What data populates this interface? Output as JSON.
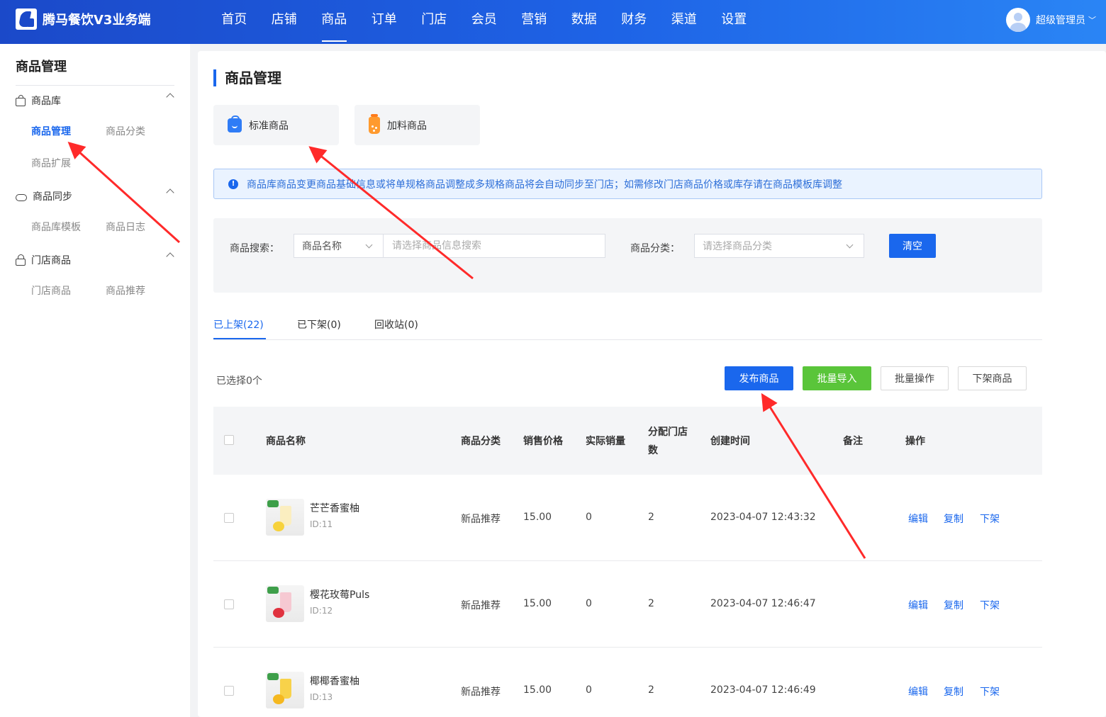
{
  "app": {
    "title": "腾马餐饮V3业务端"
  },
  "nav": [
    "首页",
    "店铺",
    "商品",
    "订单",
    "门店",
    "会员",
    "营销",
    "数据",
    "财务",
    "渠道",
    "设置"
  ],
  "user": {
    "name": "超级管理员"
  },
  "sidebar": {
    "title": "商品管理",
    "groups": [
      {
        "label": "商品库",
        "items": [
          "商品管理",
          "商品分类",
          "商品扩展"
        ]
      },
      {
        "label": "商品同步",
        "items": [
          "商品库模板",
          "商品日志"
        ]
      },
      {
        "label": "门店商品",
        "items": [
          "门店商品",
          "商品推荐"
        ]
      }
    ]
  },
  "page": {
    "title": "商品管理"
  },
  "type_cards": [
    "标准商品",
    "加料商品"
  ],
  "notice": "商品库商品变更商品基础信息或将单规格商品调整成多规格商品将会自动同步至门店；如需修改门店商品价格或库存请在商品模板库调整",
  "filter": {
    "search_label": "商品搜索：",
    "search_field": "商品名称",
    "search_placeholder": "请选择商品信息搜索",
    "category_label": "商品分类：",
    "category_placeholder": "请选择商品分类",
    "clear": "清空"
  },
  "tabs": [
    "已上架(22)",
    "已下架(0)",
    "回收站(0)"
  ],
  "toolbar": {
    "selected": "已选择0个",
    "publish": "发布商品",
    "import": "批量导入",
    "batch": "批量操作",
    "offshelf": "下架商品"
  },
  "table": {
    "headers": [
      "商品名称",
      "商品分类",
      "销售价格",
      "实际销量",
      "分配门店",
      "数",
      "创建时间",
      "备注",
      "操作"
    ],
    "rows": [
      {
        "name": "芒芒香蜜柚",
        "id": "ID:11",
        "category": "新品推荐",
        "price": "15.00",
        "sales": "0",
        "stores": "2",
        "created": "2023-04-07 12:43:32",
        "remark": ""
      },
      {
        "name": "樱花玫莓Puls",
        "id": "ID:12",
        "category": "新品推荐",
        "price": "15.00",
        "sales": "0",
        "stores": "2",
        "created": "2023-04-07 12:46:47",
        "remark": ""
      },
      {
        "name": "椰椰香蜜柚",
        "id": "ID:13",
        "category": "新品推荐",
        "price": "15.00",
        "sales": "0",
        "stores": "2",
        "created": "2023-04-07 12:46:49",
        "remark": ""
      }
    ],
    "ops": [
      "编辑",
      "复制",
      "下架"
    ]
  },
  "colors": {
    "brand": "#1a67ed",
    "header_start": "#1b49c9",
    "header_end": "#2a85f5",
    "success": "#5ac53a",
    "annotation": "#ff2a2a"
  }
}
